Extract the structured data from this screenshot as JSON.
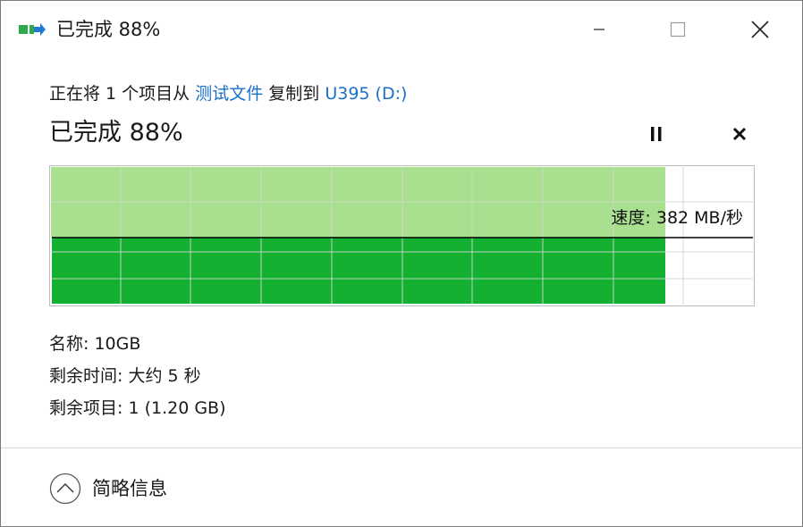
{
  "window": {
    "title": "已完成 88%",
    "icon": "file-copy-icon"
  },
  "header": {
    "prefix": "正在将 1 个项目从",
    "source": "测试文件",
    "middle": "复制到",
    "destination": "U395 (D:)"
  },
  "status": {
    "text": "已完成 88%",
    "progress_percent": 88
  },
  "controls": {
    "pause_icon": "pause-icon",
    "cancel_icon": "close-icon"
  },
  "graph": {
    "speed_label": "速度: 382 MB/秒",
    "progress_fraction": 0.88,
    "colors": {
      "fill_dark": "#14b032",
      "fill_light": "#a8e08f",
      "grid": "#cfd8cc",
      "speed_line": "#000000"
    }
  },
  "details": {
    "name_label": "名称:",
    "name_value": "10GB",
    "time_label": "剩余时间:",
    "time_value": "大约 5 秒",
    "items_label": "剩余项目:",
    "items_value": "1 (1.20 GB)"
  },
  "footer": {
    "toggle_label": "简略信息",
    "toggle_icon": "chevron-up-icon"
  },
  "colors": {
    "link": "#1a6fc9",
    "border": "#7a7a7a"
  }
}
